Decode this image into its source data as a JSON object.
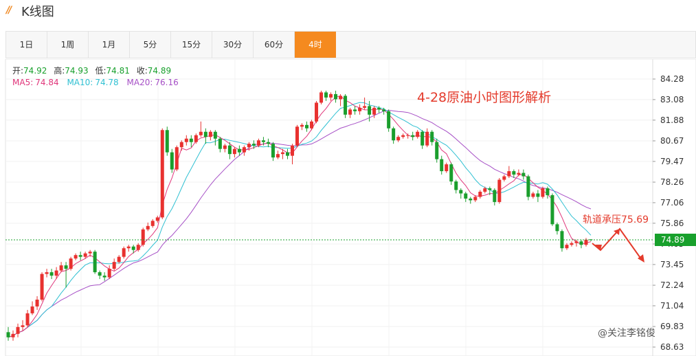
{
  "header": {
    "title": "K线图",
    "logo_icon": "double-slash-icon"
  },
  "tabs": [
    {
      "label": "1日",
      "active": false
    },
    {
      "label": "1周",
      "active": false
    },
    {
      "label": "1月",
      "active": false
    },
    {
      "label": "5分",
      "active": false
    },
    {
      "label": "15分",
      "active": false
    },
    {
      "label": "30分",
      "active": false
    },
    {
      "label": "60分",
      "active": false
    },
    {
      "label": "4时",
      "active": true
    }
  ],
  "ohlc_info": {
    "open_label": "开:",
    "open": "74.92",
    "high_label": "高:",
    "high": "74.93",
    "low_label": "低:",
    "low": "74.81",
    "close_label": "收:",
    "close": "74.89"
  },
  "ma_info": {
    "ma5_label": "MA5:",
    "ma5": "74.84",
    "ma10_label": "MA10:",
    "ma10": "74.78",
    "ma20_label": "MA20:",
    "ma20": "76.16"
  },
  "colors": {
    "up": "#e8312f",
    "down": "#1a9e2c",
    "ma5": "#e0357a",
    "ma10": "#2fc0d2",
    "ma20": "#a64fc6",
    "current_line": "#18a02c",
    "annotation": "#e43b2c",
    "tab_active": "#f58a1f"
  },
  "chart_data": {
    "type": "candlestick",
    "title": "4-28原油小时图形解析",
    "y_ticks": [
      "84.28",
      "83.08",
      "81.88",
      "80.67",
      "79.47",
      "78.26",
      "77.06",
      "75.86",
      "74.65",
      "73.45",
      "72.24",
      "71.04",
      "69.83",
      "68.63"
    ],
    "ylim": [
      68.63,
      84.28
    ],
    "current_price": "74.89",
    "annotation": "轨道承压75.69",
    "watermark": "@关注李铭俊",
    "candles": [
      [
        69.5,
        69.2,
        69.8,
        69.0
      ],
      [
        69.2,
        69.4,
        69.6,
        69.0
      ],
      [
        69.4,
        69.8,
        70.0,
        69.2
      ],
      [
        69.8,
        69.9,
        70.2,
        69.6
      ],
      [
        69.9,
        70.6,
        70.8,
        69.8
      ],
      [
        70.6,
        71.0,
        71.3,
        70.5
      ],
      [
        71.0,
        71.4,
        71.6,
        70.8
      ],
      [
        71.4,
        72.9,
        73.0,
        71.3
      ],
      [
        72.9,
        73.0,
        73.2,
        72.7
      ],
      [
        73.0,
        72.8,
        73.2,
        72.6
      ],
      [
        72.8,
        73.1,
        73.3,
        72.6
      ],
      [
        73.1,
        73.4,
        73.6,
        73.0
      ],
      [
        73.4,
        73.2,
        73.6,
        72.1
      ],
      [
        73.2,
        73.8,
        73.9,
        73.1
      ],
      [
        73.8,
        74.0,
        74.1,
        73.7
      ],
      [
        74.0,
        73.9,
        74.2,
        73.7
      ],
      [
        73.9,
        74.1,
        74.2,
        73.8
      ],
      [
        74.1,
        74.2,
        74.3,
        73.9
      ],
      [
        74.2,
        73.0,
        74.3,
        72.9
      ],
      [
        73.0,
        72.8,
        73.1,
        72.6
      ],
      [
        72.8,
        72.7,
        73.0,
        72.5
      ],
      [
        72.7,
        73.2,
        73.4,
        72.6
      ],
      [
        73.2,
        73.6,
        73.8,
        73.1
      ],
      [
        73.6,
        73.9,
        74.0,
        73.5
      ],
      [
        73.9,
        74.4,
        74.5,
        73.8
      ],
      [
        74.4,
        74.5,
        74.6,
        74.2
      ],
      [
        74.5,
        74.3,
        74.6,
        74.1
      ],
      [
        74.3,
        74.6,
        74.7,
        74.2
      ],
      [
        74.6,
        75.5,
        75.6,
        74.5
      ],
      [
        75.5,
        75.7,
        75.9,
        75.4
      ],
      [
        75.7,
        76.0,
        76.1,
        75.6
      ],
      [
        76.0,
        76.2,
        76.3,
        75.9
      ],
      [
        76.2,
        81.3,
        81.4,
        76.1
      ],
      [
        81.3,
        80.0,
        81.5,
        79.8
      ],
      [
        80.0,
        79.0,
        80.2,
        78.8
      ],
      [
        79.0,
        80.3,
        80.4,
        78.9
      ],
      [
        80.3,
        80.6,
        80.7,
        80.1
      ],
      [
        80.6,
        80.8,
        81.0,
        80.4
      ],
      [
        80.8,
        80.6,
        81.0,
        80.3
      ],
      [
        80.6,
        81.0,
        81.1,
        80.5
      ],
      [
        81.0,
        81.2,
        81.8,
        80.9
      ],
      [
        81.2,
        80.9,
        81.4,
        80.5
      ],
      [
        80.9,
        81.2,
        81.3,
        80.7
      ],
      [
        81.2,
        80.8,
        81.3,
        80.4
      ],
      [
        80.8,
        80.2,
        80.9,
        80.0
      ],
      [
        80.2,
        80.4,
        80.5,
        80.0
      ],
      [
        80.4,
        79.9,
        80.6,
        79.6
      ],
      [
        79.9,
        80.2,
        80.3,
        79.7
      ],
      [
        80.2,
        80.0,
        80.4,
        79.8
      ],
      [
        80.0,
        80.3,
        80.4,
        79.8
      ],
      [
        80.3,
        80.5,
        80.6,
        80.1
      ],
      [
        80.5,
        80.4,
        80.7,
        80.2
      ],
      [
        80.4,
        80.7,
        80.8,
        80.3
      ],
      [
        80.7,
        80.6,
        80.9,
        80.4
      ],
      [
        80.6,
        80.5,
        80.8,
        80.3
      ],
      [
        80.5,
        79.7,
        80.6,
        79.5
      ],
      [
        79.7,
        79.9,
        80.1,
        79.6
      ],
      [
        79.9,
        80.0,
        80.2,
        79.6
      ],
      [
        80.0,
        79.8,
        80.2,
        79.6
      ],
      [
        79.8,
        80.4,
        80.5,
        79.3
      ],
      [
        80.4,
        81.5,
        81.6,
        80.3
      ],
      [
        81.5,
        81.6,
        81.7,
        81.3
      ],
      [
        81.6,
        81.4,
        81.8,
        81.2
      ],
      [
        81.4,
        81.8,
        81.9,
        81.3
      ],
      [
        81.8,
        82.9,
        83.0,
        81.7
      ],
      [
        82.9,
        83.5,
        83.6,
        82.8
      ],
      [
        83.5,
        83.2,
        83.6,
        83.0
      ],
      [
        83.2,
        83.4,
        83.5,
        83.0
      ],
      [
        83.4,
        83.1,
        83.6,
        82.9
      ],
      [
        83.1,
        83.3,
        83.4,
        82.7
      ],
      [
        83.3,
        82.2,
        83.4,
        82.0
      ],
      [
        82.2,
        82.5,
        82.6,
        82.0
      ],
      [
        82.5,
        82.4,
        82.7,
        82.2
      ],
      [
        82.4,
        82.6,
        82.8,
        82.2
      ],
      [
        82.6,
        82.7,
        83.2,
        82.5
      ],
      [
        82.7,
        82.2,
        83.0,
        81.8
      ],
      [
        82.2,
        82.6,
        82.7,
        82.0
      ],
      [
        82.6,
        82.5,
        82.7,
        82.3
      ],
      [
        82.5,
        82.4,
        82.6,
        82.2
      ],
      [
        82.4,
        81.4,
        82.5,
        81.2
      ],
      [
        81.4,
        80.7,
        81.5,
        80.5
      ],
      [
        80.7,
        80.9,
        81.0,
        80.6
      ],
      [
        80.9,
        81.0,
        81.1,
        80.8
      ],
      [
        81.0,
        81.0,
        81.1,
        80.8
      ],
      [
        81.0,
        80.9,
        81.2,
        80.7
      ],
      [
        80.9,
        81.2,
        81.3,
        80.8
      ],
      [
        81.2,
        80.4,
        81.3,
        80.2
      ],
      [
        80.4,
        81.2,
        81.4,
        80.3
      ],
      [
        81.2,
        80.6,
        81.3,
        80.4
      ],
      [
        80.6,
        79.6,
        80.8,
        79.4
      ],
      [
        79.6,
        78.9,
        79.8,
        78.7
      ],
      [
        78.9,
        79.3,
        79.4,
        78.8
      ],
      [
        79.3,
        78.3,
        79.4,
        78.1
      ],
      [
        78.3,
        77.8,
        78.4,
        77.6
      ],
      [
        77.8,
        77.6,
        77.9,
        77.3
      ],
      [
        77.6,
        77.3,
        77.7,
        77.1
      ],
      [
        77.3,
        77.2,
        77.4,
        77.0
      ],
      [
        77.2,
        77.4,
        77.5,
        77.1
      ],
      [
        77.4,
        77.7,
        77.8,
        77.3
      ],
      [
        77.7,
        77.9,
        78.0,
        77.6
      ],
      [
        77.9,
        77.8,
        78.0,
        77.5
      ],
      [
        77.8,
        77.1,
        77.9,
        76.9
      ],
      [
        77.1,
        78.4,
        78.5,
        77.0
      ],
      [
        78.4,
        78.6,
        78.7,
        78.3
      ],
      [
        78.6,
        78.9,
        79.2,
        78.5
      ],
      [
        78.9,
        78.7,
        79.0,
        78.5
      ],
      [
        78.7,
        78.8,
        79.0,
        78.6
      ],
      [
        78.8,
        78.6,
        79.0,
        78.4
      ],
      [
        78.6,
        77.4,
        78.7,
        77.2
      ],
      [
        77.4,
        77.6,
        77.7,
        77.3
      ],
      [
        77.6,
        77.4,
        77.8,
        77.1
      ],
      [
        77.4,
        77.9,
        78.0,
        77.3
      ],
      [
        77.9,
        77.5,
        78.0,
        77.3
      ],
      [
        77.5,
        75.8,
        77.6,
        75.7
      ],
      [
        75.8,
        75.4,
        75.9,
        75.2
      ],
      [
        75.4,
        74.4,
        75.5,
        74.2
      ],
      [
        74.4,
        74.6,
        74.7,
        74.3
      ],
      [
        74.6,
        74.7,
        74.8,
        74.5
      ],
      [
        74.7,
        74.8,
        74.9,
        74.5
      ],
      [
        74.8,
        74.6,
        74.9,
        74.4
      ],
      [
        74.6,
        74.9,
        75.0,
        74.5
      ],
      [
        74.92,
        74.89,
        74.93,
        74.81
      ]
    ]
  }
}
